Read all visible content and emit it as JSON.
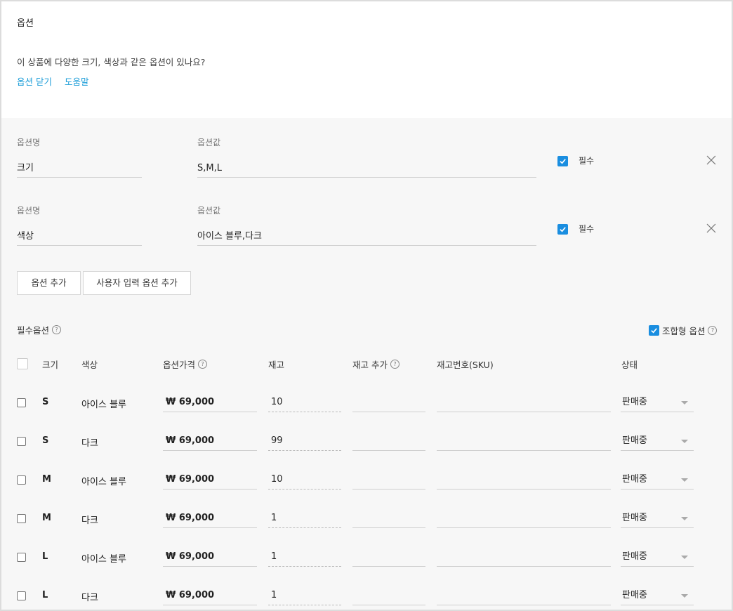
{
  "section": {
    "title": "옵션",
    "question": "이 상품에 다양한 크기, 색상과 같은 옵션이 있나요?",
    "link_close": "옵션 닫기",
    "link_help": "도움말"
  },
  "options": [
    {
      "name_label": "옵션명",
      "name": "크기",
      "value_label": "옵션값",
      "value": "S,M,L",
      "required": true,
      "required_label": "필수"
    },
    {
      "name_label": "옵션명",
      "name": "색상",
      "value_label": "옵션값",
      "value": "아이스 블루,다크",
      "required": true,
      "required_label": "필수"
    }
  ],
  "buttons": {
    "add_option": "옵션 추가",
    "add_custom": "사용자 입력 옵션 추가"
  },
  "required_options": {
    "title": "필수옵션",
    "combo_label": "조합형 옵션",
    "combo_checked": true
  },
  "table": {
    "headers": {
      "size": "크기",
      "color": "색상",
      "price": "옵션가격",
      "stock": "재고",
      "stock_add": "재고 추가",
      "sku": "재고번호(SKU)",
      "status": "상태"
    },
    "rows": [
      {
        "size": "S",
        "color": "아이스 블루",
        "price": "₩ 69,000",
        "stock": "10",
        "stock_add": "",
        "sku": "",
        "status": "판매중"
      },
      {
        "size": "S",
        "color": "다크",
        "price": "₩ 69,000",
        "stock": "99",
        "stock_add": "",
        "sku": "",
        "status": "판매중"
      },
      {
        "size": "M",
        "color": "아이스 블루",
        "price": "₩ 69,000",
        "stock": "10",
        "stock_add": "",
        "sku": "",
        "status": "판매중"
      },
      {
        "size": "M",
        "color": "다크",
        "price": "₩ 69,000",
        "stock": "1",
        "stock_add": "",
        "sku": "",
        "status": "판매중"
      },
      {
        "size": "L",
        "color": "아이스 블루",
        "price": "₩ 69,000",
        "stock": "1",
        "stock_add": "",
        "sku": "",
        "status": "판매중"
      },
      {
        "size": "L",
        "color": "다크",
        "price": "₩ 69,000",
        "stock": "1",
        "stock_add": "",
        "sku": "",
        "status": "판매중"
      }
    ]
  },
  "colors": {
    "accent": "#1a8ee0",
    "link": "#1a9cd8",
    "panel_bg": "#f7f7f7"
  },
  "icons": {
    "check": "check-icon",
    "remove": "close-icon",
    "help": "help-icon",
    "dropdown": "chevron-down-icon"
  }
}
